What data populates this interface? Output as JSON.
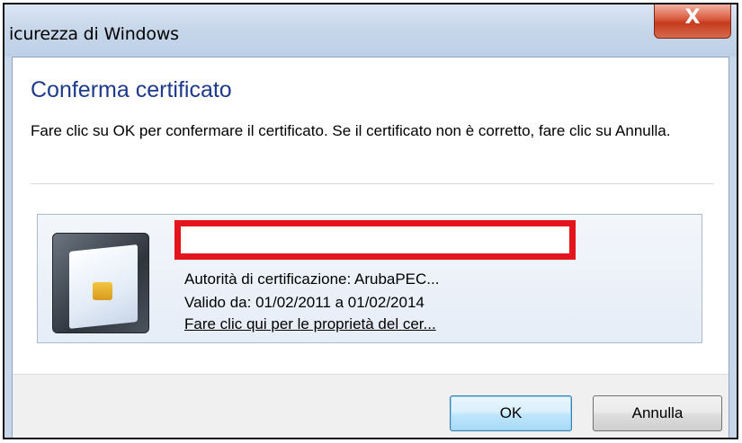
{
  "window": {
    "title": "icurezza di Windows",
    "close_glyph": "X"
  },
  "dialog": {
    "heading": "Conferma certificato",
    "description": "Fare clic su OK per confermare il certificato. Se il certificato non è corretto, fare clic su Annulla."
  },
  "certificate": {
    "icon": "smart-card-icon",
    "subject_redacted": "",
    "issuer": "Autorità di certificazione: ArubaPEC...",
    "validity": "Valido da: 01/02/2011 a 01/02/2014",
    "properties_link": "Fare clic qui per le proprietà del cer..."
  },
  "buttons": {
    "ok": "OK",
    "cancel": "Annulla"
  },
  "colors": {
    "heading": "#1e3a8a",
    "redaction": "#e3141b",
    "close_button": "#c53a1c"
  }
}
